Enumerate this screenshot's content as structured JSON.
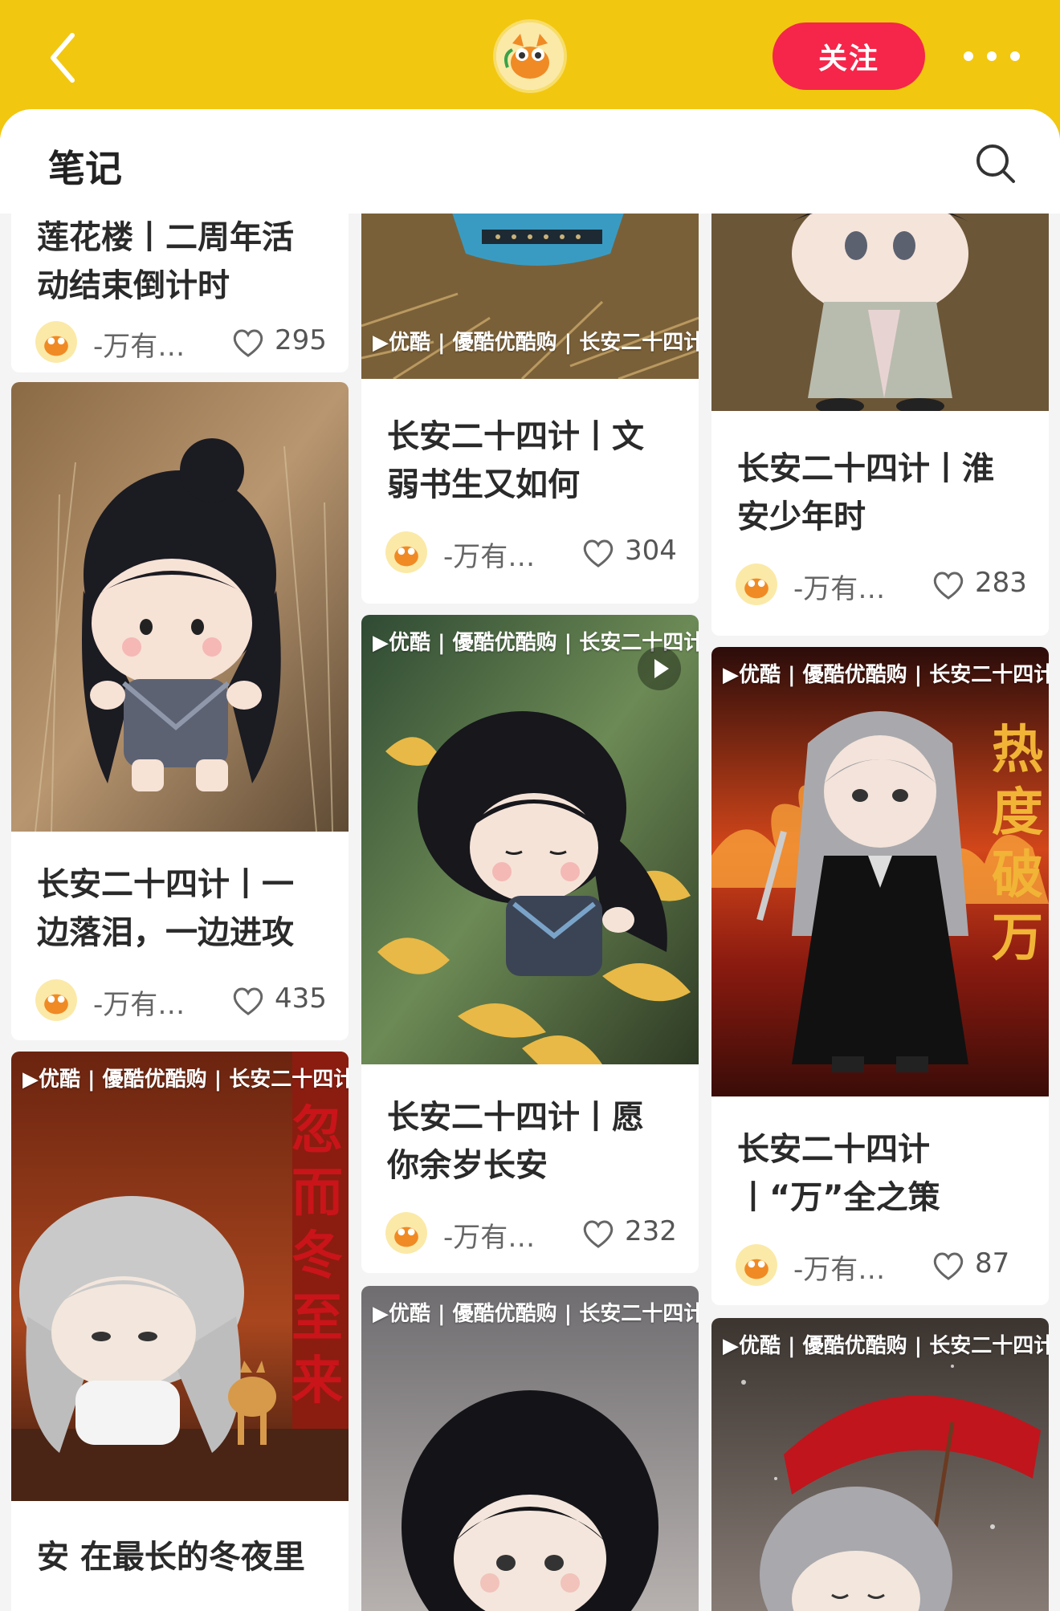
{
  "header": {
    "follow_label": "关注",
    "back_icon": "chevron-left-icon",
    "more_icon": "more-dots-icon"
  },
  "panel": {
    "title": "笔记",
    "search_icon": "search-icon"
  },
  "brand_strip": "▶优酷 | 優酷优酷购 | 长安二十四计",
  "cards": [
    {
      "title_lines": [
        "莲花楼丨二周年活",
        "动结束倒计时"
      ],
      "author": "-万有…",
      "likes": "295"
    },
    {
      "title_lines": [
        "长安二十四计丨一",
        "边落泪，一边进攻"
      ],
      "author": "-万有…",
      "likes": "435"
    },
    {
      "title_lines": [
        "安 在最长的冬夜里",
        ""
      ],
      "author": "",
      "likes": ""
    },
    {
      "title_lines": [
        "长安二十四计丨文",
        "弱书生又如何"
      ],
      "author": "-万有…",
      "likes": "304"
    },
    {
      "title_lines": [
        "长安二十四计丨愿",
        "你余岁长安"
      ],
      "author": "-万有…",
      "likes": "232"
    },
    {
      "title_lines": [
        "长安二十四计丨淮",
        "安少年时"
      ],
      "author": "-万有…",
      "likes": "283"
    },
    {
      "title_lines": [
        "长安二十四计",
        "丨“万”全之策"
      ],
      "author": "-万有…",
      "likes": "87"
    }
  ],
  "poster_texts": {
    "winter": "忽而冬至来",
    "fire": "热度破万"
  },
  "colors": {
    "header_yellow": "#f2c70f",
    "follow_red": "#f5264a"
  }
}
